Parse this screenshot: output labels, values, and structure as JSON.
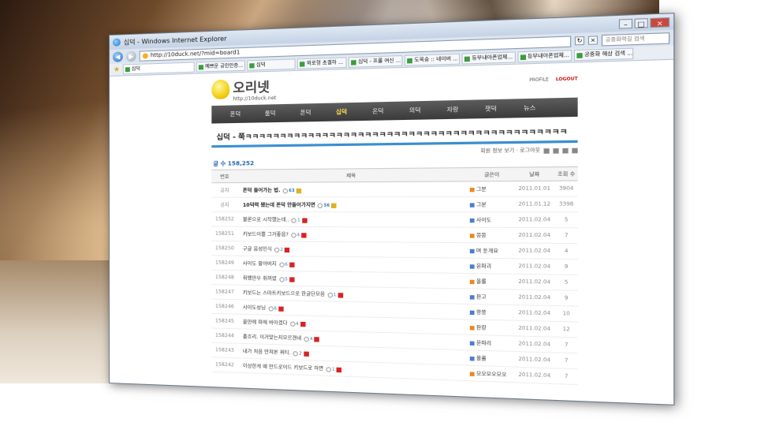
{
  "window": {
    "title": "십덕 - Windows Internet Explorer",
    "url": "http://10duck.net/?mid=board1",
    "search_placeholder": "공중화력길 검색"
  },
  "tabs": [
    {
      "label": "십덕"
    },
    {
      "label": "예쁘운 공인인증..."
    },
    {
      "label": "십덕"
    },
    {
      "label": "외로형 초겔하 ..."
    },
    {
      "label": "십덕 - 프롤 여신 ..."
    },
    {
      "label": "도목숭 :: 네이버 ..."
    },
    {
      "label": "등부내아폰업체..."
    },
    {
      "label": "등부내아폰업체..."
    },
    {
      "label": "공중화 해상 검색 ..."
    }
  ],
  "site": {
    "name": "오리넷",
    "url": "http://10duck.net",
    "top_links": [
      "PROFILE",
      "LOGOUT"
    ]
  },
  "menu": [
    "폰덕",
    "룸덕",
    "폰덕",
    "십덕",
    "온덕",
    "의덕",
    "자랑",
    "잿덕",
    "뉴스"
  ],
  "board": {
    "title": "십덕 - 쭉ㅋㅋㅋㅋㅋㅋㅋㅋㅋㅋㅋㅋㅋㅋㅋㅋㅋㅋㅋㅋㅋㅋㅋㅋㅋㅋㅋㅋㅋㅋㅋㅋㅋㅋㅋㅋㅋㅋㅋㅋㅋㅋㅋㅋ",
    "tools": "회원 정보 보기 · 로그아웃",
    "count_label": "글 수",
    "count": "158,252",
    "headers": {
      "num": "번호",
      "subject": "제목",
      "writer": "글쓴이",
      "date": "날짜",
      "views": "조회 수"
    },
    "rows": [
      {
        "num": "공지",
        "subject": "폰덕 들어가는 법.",
        "comments": "63",
        "writer": "그분",
        "date": "2011.01.01",
        "views": "3904",
        "notice": true
      },
      {
        "num": "공지",
        "subject": "10덕력 됐는데 폰덕 안들어가지면",
        "comments": "56",
        "writer": "그분",
        "date": "2011.01.12",
        "views": "3398",
        "notice": true
      },
      {
        "num": "158252",
        "subject": "불론으로 시작했는데..",
        "comments": "1",
        "writer": "사이도",
        "date": "2011.02.04",
        "views": "5"
      },
      {
        "num": "158251",
        "subject": "키보드이쁠 그거좋음?",
        "comments": "4",
        "writer": "쫑쫑",
        "date": "2011.02.04",
        "views": "7"
      },
      {
        "num": "158250",
        "subject": "구글 음성인식",
        "comments": "2",
        "writer": "며 둔개요",
        "date": "2011.02.04",
        "views": "4"
      },
      {
        "num": "158249",
        "subject": "사이도 할아버지",
        "comments": "6",
        "writer": "윤파괴",
        "date": "2011.02.04",
        "views": "9"
      },
      {
        "num": "158248",
        "subject": "쥐쨌만우 쥐꺼였",
        "comments": "5",
        "writer": "올롤",
        "date": "2011.02.04",
        "views": "5"
      },
      {
        "num": "158247",
        "subject": "키보드는 스마트키보드으로 한글단모음",
        "comments": "1",
        "writer": "판고",
        "date": "2011.02.04",
        "views": "9"
      },
      {
        "num": "158246",
        "subject": "사이도성님",
        "comments": "6",
        "writer": "쫑쫑",
        "date": "2011.02.04",
        "views": "10"
      },
      {
        "num": "158245",
        "subject": "울만에 파에 바아겠다",
        "comments": "4",
        "writer": "판랑",
        "date": "2011.02.04",
        "views": "12"
      },
      {
        "num": "158244",
        "subject": "흘흐리. 이거맞는지모르겐네",
        "comments": "4",
        "writer": "윤파리",
        "date": "2011.02.04",
        "views": "7"
      },
      {
        "num": "158243",
        "subject": "내가 처음 만져본 쿼티.",
        "comments": "2",
        "writer": "올롤",
        "date": "2011.02.04",
        "views": "7"
      },
      {
        "num": "158242",
        "subject": "이상한게 왜 안드로이드 키보드로 하면",
        "comments": "1",
        "writer": "모오모오모오",
        "date": "2011.02.04",
        "views": "7"
      }
    ]
  }
}
